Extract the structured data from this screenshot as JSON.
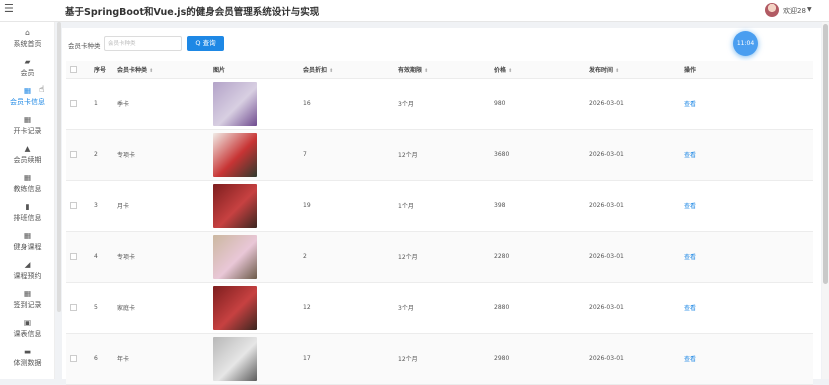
{
  "header": {
    "title": "基于SpringBoot和Vue.js的健身会员管理系统设计与实现",
    "welcome": "欢迎28",
    "caret": "▼",
    "menu_icon": "☰"
  },
  "sidebar": {
    "items": [
      {
        "icon": "⌂",
        "icon_name": "home-icon",
        "label": "系统首页"
      },
      {
        "icon": "▰",
        "icon_name": "member-icon",
        "label": "会员"
      },
      {
        "icon": "▦",
        "icon_name": "card-info-icon",
        "label": "会员卡信息",
        "active": true
      },
      {
        "icon": "▦",
        "icon_name": "card-record-icon",
        "label": "开卡记录"
      },
      {
        "icon": "▲",
        "icon_name": "renew-icon",
        "label": "会员续期"
      },
      {
        "icon": "▦",
        "icon_name": "coach-icon",
        "label": "教练信息"
      },
      {
        "icon": "▮",
        "icon_name": "class-icon",
        "label": "排班信息"
      },
      {
        "icon": "▦",
        "icon_name": "course-icon",
        "label": "健身课程"
      },
      {
        "icon": "◢",
        "icon_name": "booking-icon",
        "label": "课程预约"
      },
      {
        "icon": "▦",
        "icon_name": "checkin-icon",
        "label": "签到记录"
      },
      {
        "icon": "▣",
        "icon_name": "schedule-icon",
        "label": "课表信息"
      },
      {
        "icon": "▬",
        "icon_name": "body-data-icon",
        "label": "体测数据"
      }
    ]
  },
  "search": {
    "label": "会员卡种类",
    "placeholder": "会员卡种类",
    "button": "Q 查询"
  },
  "clock": "11:04",
  "table": {
    "sort_glyph": "⬍",
    "headers": [
      "序号",
      "会员卡种类",
      "图片",
      "会员折扣",
      "有效期限",
      "价格",
      "发布时间",
      "操作"
    ],
    "rows": [
      {
        "no": "1",
        "type": "季卡",
        "discount": "16",
        "period": "3个月",
        "price": "980",
        "date": "2026-03-01",
        "action": "查看",
        "img": [
          "#b3a3c8",
          "#d8cfe2",
          "#6f4b8f"
        ]
      },
      {
        "no": "2",
        "type": "专项卡",
        "discount": "7",
        "period": "12个月",
        "price": "3680",
        "date": "2026-03-01",
        "action": "查看",
        "img": [
          "#f1ece7",
          "#c73434",
          "#2f3a2e"
        ]
      },
      {
        "no": "3",
        "type": "月卡",
        "discount": "19",
        "period": "1个月",
        "price": "398",
        "date": "2026-03-01",
        "action": "查看",
        "img": [
          "#7d1e1e",
          "#c74141",
          "#3b2620"
        ]
      },
      {
        "no": "4",
        "type": "专项卡",
        "discount": "2",
        "period": "12个月",
        "price": "2280",
        "date": "2026-03-01",
        "action": "查看",
        "img": [
          "#cbb8a0",
          "#e9c7d7",
          "#6b5a48"
        ]
      },
      {
        "no": "5",
        "type": "家庭卡",
        "discount": "12",
        "period": "3个月",
        "price": "2880",
        "date": "2026-03-01",
        "action": "查看",
        "img": [
          "#7d1e1e",
          "#c74141",
          "#3b2620"
        ]
      },
      {
        "no": "6",
        "type": "年卡",
        "discount": "17",
        "period": "12个月",
        "price": "2980",
        "date": "2026-03-01",
        "action": "查看",
        "img": [
          "#b8b8b8",
          "#e6e6e6",
          "#5c5c5c"
        ]
      }
    ]
  }
}
